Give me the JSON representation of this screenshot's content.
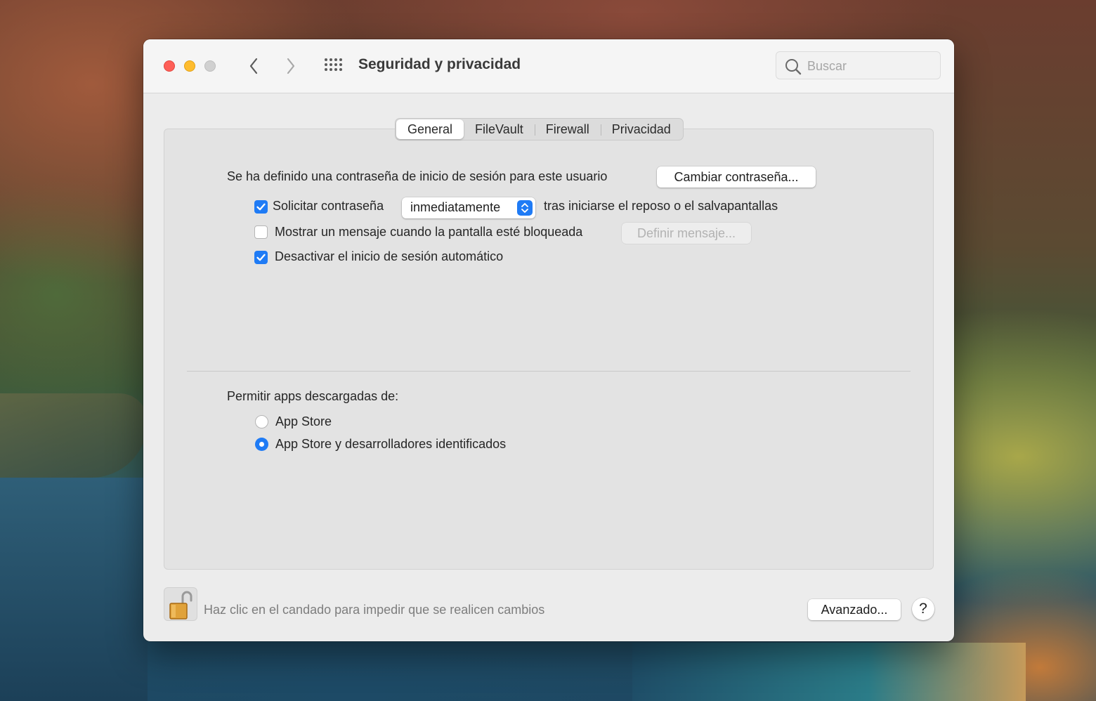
{
  "window": {
    "title": "Seguridad y privacidad",
    "search_placeholder": "Buscar"
  },
  "tabs": [
    {
      "label": "General",
      "active": true
    },
    {
      "label": "FileVault",
      "active": false
    },
    {
      "label": "Firewall",
      "active": false
    },
    {
      "label": "Privacidad",
      "active": false
    }
  ],
  "general": {
    "password_text": "Se ha definido una contraseña de inicio de sesión para este usuario",
    "change_password_button": "Cambiar contraseña...",
    "require_password": {
      "label": "Solicitar contraseña",
      "checked": true
    },
    "require_password_delay": "inmediatamente",
    "require_password_suffix": "tras iniciarse el reposo o el salvapantallas",
    "show_message": {
      "label": "Mostrar un mensaje cuando la pantalla esté bloqueada",
      "checked": false
    },
    "set_message_button": "Definir mensaje...",
    "disable_auto_login": {
      "label": "Desactivar el inicio de sesión automático",
      "checked": true
    }
  },
  "downloads": {
    "heading": "Permitir apps descargadas de:",
    "options": [
      {
        "label": "App Store",
        "selected": false
      },
      {
        "label": "App Store y desarrolladores identificados",
        "selected": true
      }
    ]
  },
  "footer": {
    "lock_text": "Haz clic en el candado para impedir que se realicen cambios",
    "advanced_button": "Avanzado...",
    "help_label": "?"
  },
  "colors": {
    "accent": "#1f7bf5",
    "close": "#fe5f57",
    "minimize": "#febc2e",
    "zoom_inactive": "#d0d0d0"
  }
}
